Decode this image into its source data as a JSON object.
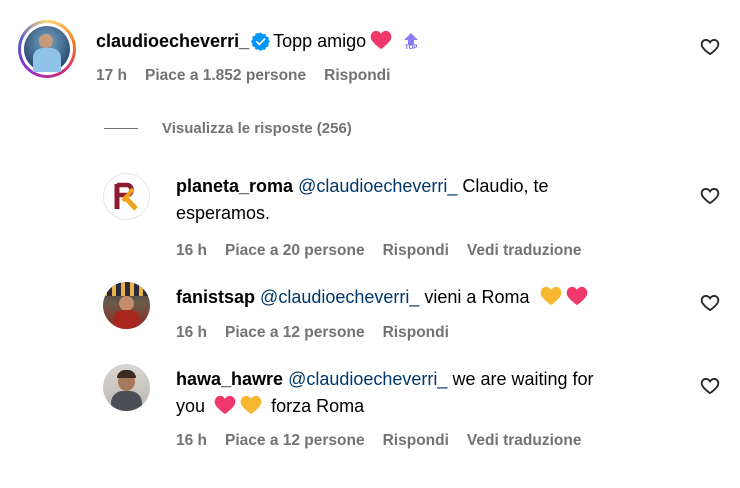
{
  "main_comment": {
    "username": "claudioecheverri_",
    "text": "Topp amigo",
    "time": "17 h",
    "likes": "Piace a 1.852 persone",
    "reply": "Rispondi",
    "verified_icon": "verified-badge-icon",
    "emoji": "pink-heart",
    "badge": "TOP",
    "badge_color": "#8a7cf0"
  },
  "view_replies": "Visualizza le risposte (256)",
  "replies": [
    {
      "username": "planeta_roma",
      "mention": "@claudioecheverri_",
      "text_line1": " Claudio, te",
      "text_line2": "esperamos.",
      "time": "16 h",
      "likes": "Piace a 20 persone",
      "reply": "Rispondi",
      "translate": "Vedi traduzione"
    },
    {
      "username": "fanistsap",
      "mention": "@claudioecheverri_",
      "text": " vieni a Roma",
      "time": "16 h",
      "likes": "Piace a 12 persone",
      "reply": "Rispondi"
    },
    {
      "username": "hawa_hawre",
      "mention": "@claudioecheverri_",
      "text_line1": " we are waiting for",
      "text_line2": "you",
      "text_line2_tail": "forza Roma",
      "time": "16 h",
      "likes": "Piace a 12 persone",
      "reply": "Rispondi",
      "translate": "Vedi traduzione"
    }
  ],
  "colors": {
    "meta_grey": "#737373",
    "mention_blue": "#00376b",
    "heart_pink": "#f0386b",
    "heart_yellow": "#f7b731",
    "verified_blue": "#0095f6"
  }
}
